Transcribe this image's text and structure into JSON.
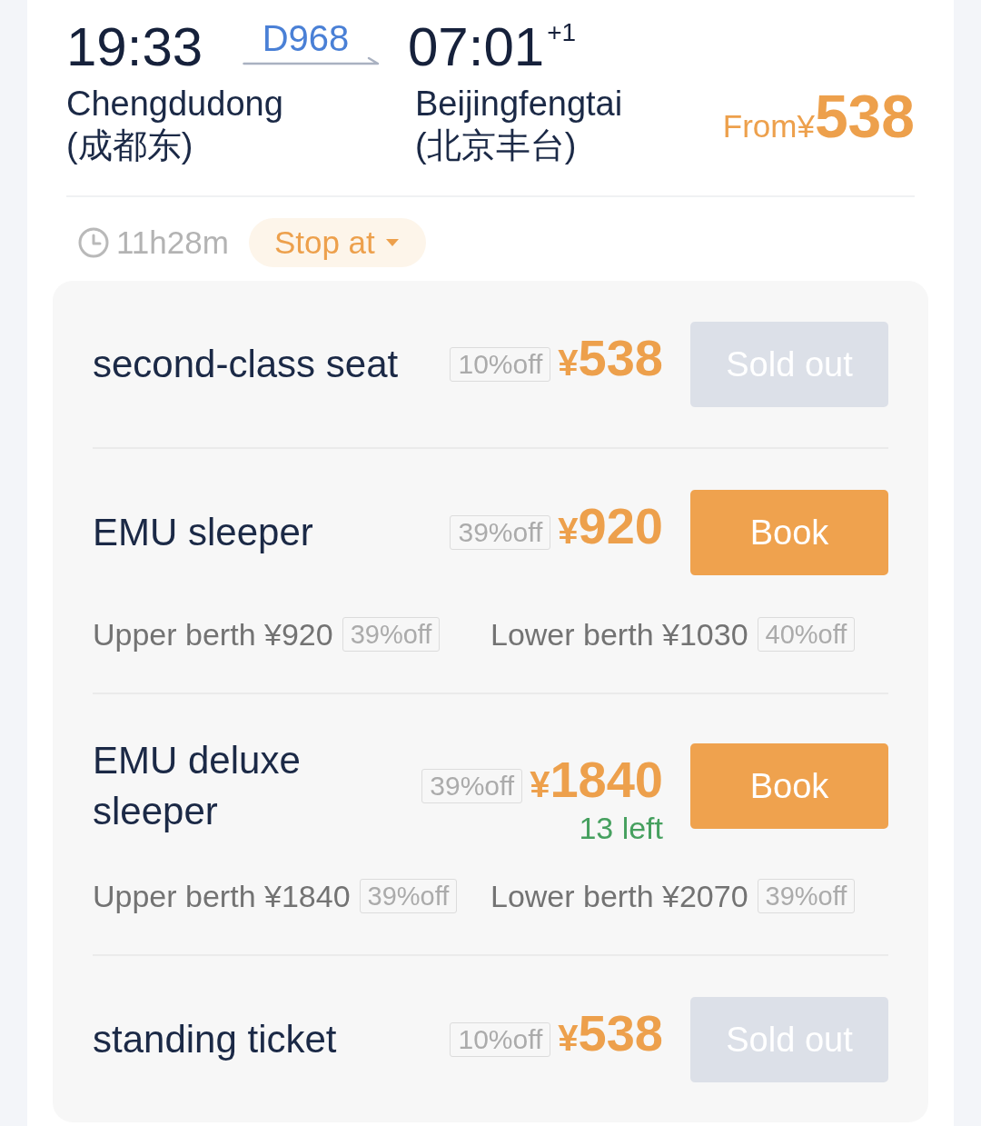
{
  "journey": {
    "departure_time": "19:33",
    "train_number": "D968",
    "arrival_time": "07:01",
    "arrival_day_offset": "+1",
    "from_station": "Chengdudong",
    "from_station_local": "(成都东)",
    "to_station": "Beijingfengtai",
    "to_station_local": "(北京丰台)",
    "price_prefix": "From¥",
    "lowest_price": "538"
  },
  "info_bar": {
    "duration": "11h28m",
    "stops_button": "Stop at"
  },
  "seats": [
    {
      "name": "second-class seat",
      "discount": "10%off",
      "currency": "¥",
      "price": "538",
      "button": {
        "label": "Sold out",
        "disabled": true
      }
    },
    {
      "name": "EMU sleeper",
      "discount": "39%off",
      "currency": "¥",
      "price": "920",
      "button": {
        "label": "Book",
        "disabled": false
      },
      "berths": [
        {
          "text": "Upper berth ¥920",
          "discount": "39%off"
        },
        {
          "text": "Lower berth ¥1030",
          "discount": "40%off"
        }
      ]
    },
    {
      "name": "EMU deluxe sleeper",
      "discount": "39%off",
      "currency": "¥",
      "price": "1840",
      "remaining": "13 left",
      "button": {
        "label": "Book",
        "disabled": false
      },
      "berths": [
        {
          "text": "Upper berth ¥1840",
          "discount": "39%off"
        },
        {
          "text": "Lower berth ¥2070",
          "discount": "39%off"
        }
      ]
    },
    {
      "name": "standing ticket",
      "discount": "10%off",
      "currency": "¥",
      "price": "538",
      "button": {
        "label": "Sold out",
        "disabled": true
      }
    }
  ]
}
